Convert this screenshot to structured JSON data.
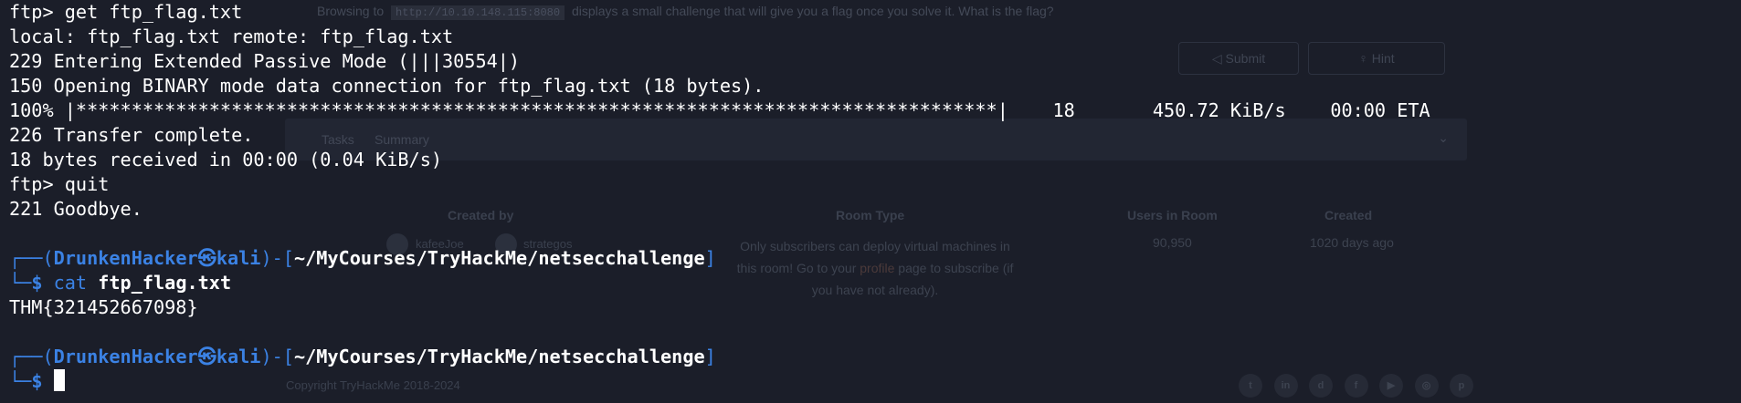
{
  "background_page": {
    "intro_prefix": "Browsing to",
    "intro_url": "http://10.10.148.115:8080",
    "intro_suffix": "displays a small challenge that will give you a flag once you solve it. What is the flag?",
    "submit_label": "Submit",
    "hint_label": "Hint",
    "tabs": [
      "Tasks",
      "Summary"
    ],
    "table_headers": {
      "created_by": "Created by",
      "room_type": "Room Type",
      "users_in_room": "Users in Room",
      "created": "Created"
    },
    "creators": [
      "kafeeJoe",
      "strategos"
    ],
    "room_type_text_1": "Only subscribers can deploy virtual machines in",
    "room_type_text_2a": "this room! Go to your",
    "room_type_link": "profile",
    "room_type_text_2b": "page to subscribe (if",
    "room_type_text_3": "you have not already).",
    "users_in_room": "90,950",
    "created": "1020 days ago",
    "copyright": "Copyright TryHackMe 2018-2024",
    "social_icons": [
      "twitter-icon",
      "linkedin-icon",
      "discord-icon",
      "facebook-icon",
      "youtube-icon",
      "instagram-icon",
      "pinterest-icon"
    ]
  },
  "terminal": {
    "lines": [
      "ftp> get ftp_flag.txt",
      "local: ftp_flag.txt remote: ftp_flag.txt",
      "229 Entering Extended Passive Mode (|||30554|)",
      "150 Opening BINARY mode data connection for ftp_flag.txt (18 bytes).",
      "100% |***********************************************************************************|    18       450.72 KiB/s    00:00 ETA",
      "226 Transfer complete.",
      "18 bytes received in 00:00 (0.04 KiB/s)",
      "ftp> quit",
      "221 Goodbye."
    ],
    "prompt1": {
      "open": "┌──(",
      "user": "DrunkenHacker",
      "skull": "㉿",
      "host": "kali",
      "mid": ")-[",
      "path": "~/MyCourses/TryHackMe/netsecchallenge",
      "close": "]",
      "corner": "└─",
      "dollar": "$",
      "command": "cat",
      "argument": "ftp_flag.txt"
    },
    "flag_output": "THM{321452667098}",
    "prompt2": {
      "open": "┌──(",
      "user": "DrunkenHacker",
      "skull": "㉿",
      "host": "kali",
      "mid": ")-[",
      "path": "~/MyCourses/TryHackMe/netsecchallenge",
      "close": "]",
      "corner": "└─",
      "dollar": "$"
    }
  },
  "colors": {
    "terminal_bg": "#1b1e29",
    "prompt_blue": "#3b82e4",
    "text": "#ffffff"
  }
}
